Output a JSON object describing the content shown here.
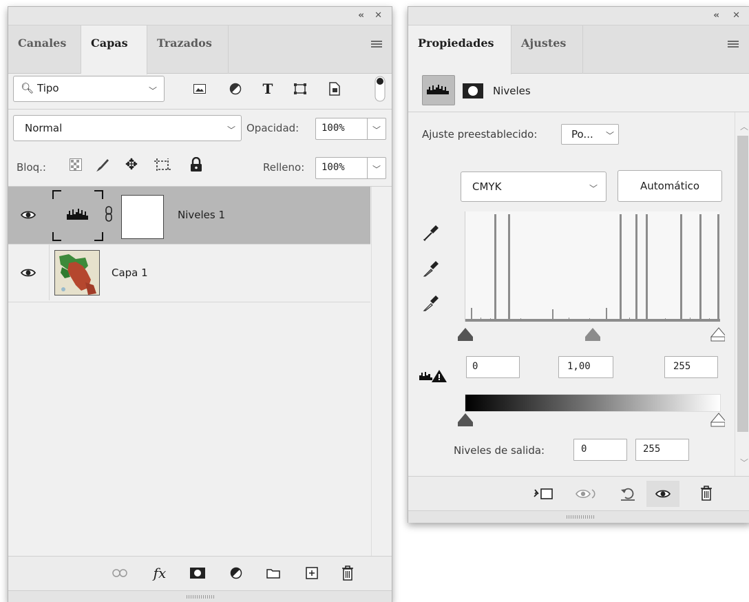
{
  "layers_panel": {
    "tabs": [
      {
        "label": "Canales"
      },
      {
        "label": "Capas"
      },
      {
        "label": "Trazados"
      }
    ],
    "filter": {
      "label": "Tipo"
    },
    "blend_mode": "Normal",
    "opacity": {
      "label": "Opacidad:",
      "value": "100%"
    },
    "lock": {
      "label": "Bloq.:"
    },
    "fill": {
      "label": "Relleno:",
      "value": "100%"
    },
    "layers": [
      {
        "name": "Niveles 1",
        "visible": true,
        "selected": true
      },
      {
        "name": "Capa 1",
        "visible": true,
        "selected": false
      }
    ]
  },
  "properties_panel": {
    "tabs": [
      {
        "label": "Propiedades"
      },
      {
        "label": "Ajustes"
      }
    ],
    "header_label": "Niveles",
    "preset": {
      "label": "Ajuste preestablecido:",
      "value": "Po..."
    },
    "channel": "CMYK",
    "auto_button": "Automático",
    "input_levels": {
      "black": "0",
      "gamma": "1,00",
      "white": "255"
    },
    "output_levels": {
      "label": "Niveles de salida:",
      "black": "0",
      "white": "255"
    }
  },
  "colors": {
    "accent_selected": "#b7b7b7",
    "panel_bg": "#f0f0f0"
  }
}
